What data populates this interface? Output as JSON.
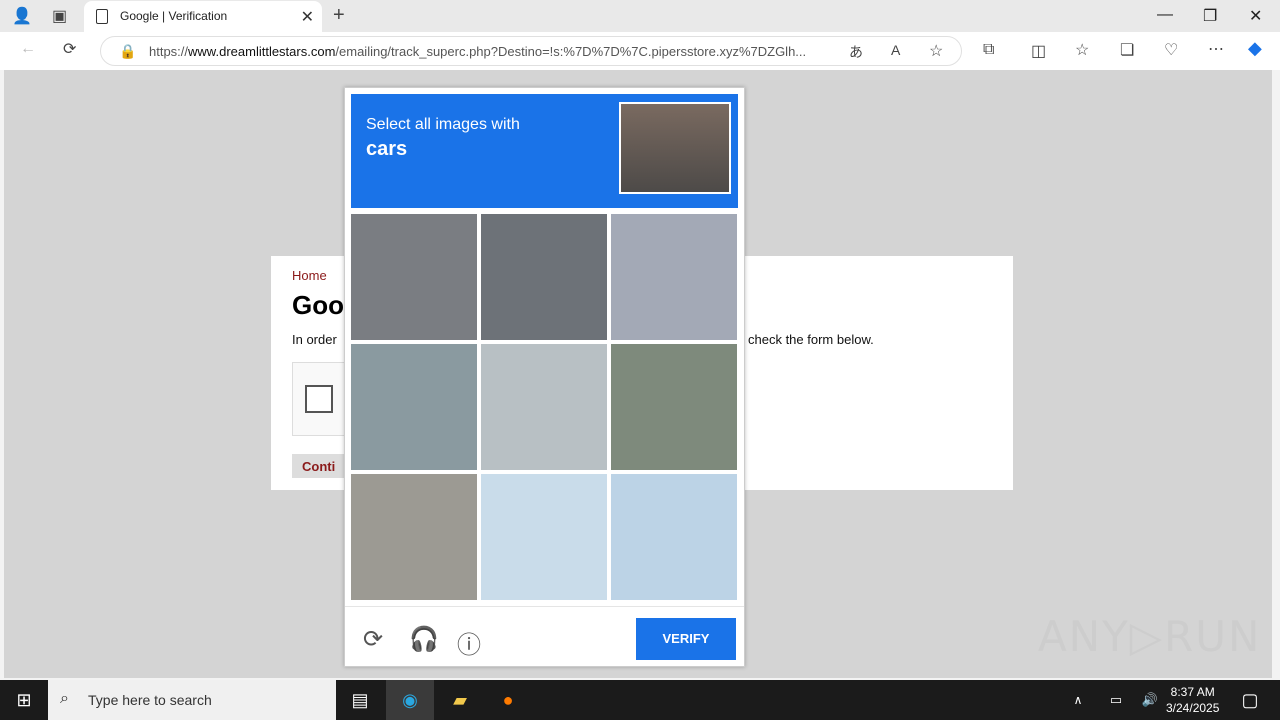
{
  "browser": {
    "tab_title": "Google | Verification",
    "url_prefix": "https://",
    "url_domain": "www.dreamlittlestars.com",
    "url_path": "/emailing/track_superc.php?Destino=!s:%7D%7D%7C.pipersstore.xyz%7DZGlh...",
    "new_tab": "+",
    "close_tab": "✕",
    "minimize": "—",
    "maximize": "❐",
    "close_window": "✕"
  },
  "page": {
    "breadcrumb": "Home",
    "heading": "Goo",
    "order_text": "In order",
    "order_text_right": "check the form below.",
    "continue_label": "Conti"
  },
  "captcha": {
    "instruction": "Select all images with",
    "target": "cars",
    "verify_label": "VERIFY",
    "tiles": [
      {
        "name": "tile-car-interior",
        "bg": "#7a7d82"
      },
      {
        "name": "tile-car-bridge",
        "bg": "#6d7278"
      },
      {
        "name": "tile-city-street",
        "bg": "#a3a9b6"
      },
      {
        "name": "tile-traffic-light",
        "bg": "#8a9aa0"
      },
      {
        "name": "tile-trees-signal",
        "bg": "#b8c0c4"
      },
      {
        "name": "tile-street-buildings",
        "bg": "#7e8a7c"
      },
      {
        "name": "tile-overpass-road",
        "bg": "#9c9a93"
      },
      {
        "name": "tile-sky-poles",
        "bg": "#c9dcea"
      },
      {
        "name": "tile-houses",
        "bg": "#bcd3e6"
      }
    ]
  },
  "watermark": "ANY▷RUN",
  "taskbar": {
    "search_placeholder": "Type here to search",
    "time": "8:37 AM",
    "date": "3/24/2025"
  }
}
